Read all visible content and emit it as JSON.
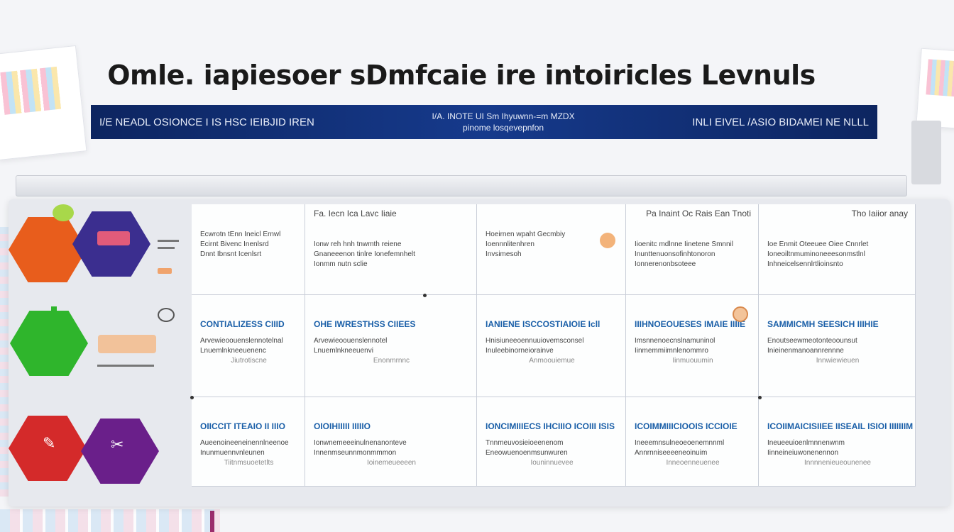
{
  "title": "Omle. iapiesoer sDmfcaie ire intoiricles Levnuls",
  "banner": {
    "left": "I/E NEADL OSIONCE   I IS HSC IEIBJID IREN",
    "center_top": "I/A. INOTE UI Sm Ihyuwnn-=m MZDX",
    "center_bottom": "pinome losqevepnfon",
    "right": "INLI EIVEL /ASIO BIDAMEI NE NLLL"
  },
  "table": {
    "headers": [
      "",
      "Fa. Iecn Ica Lavc Iiaie",
      "",
      "Pa Inaint Oc Rais Ean Tnoti",
      "Tho Iaiior anay"
    ],
    "rows": [
      {
        "icon_colors": [
          "#e85d1c",
          "#3b2e8f"
        ],
        "cells": [
          {
            "title": "",
            "lines": [
              "Ecwrotn tEnn Ineicl Ernwl",
              "Ecirnt Bivenc Inenlsrd",
              "Dnnt Ibnsnt Icenlsrt"
            ]
          },
          {
            "title": "",
            "lines": [
              "Ionw reh hnh tnwmth reiene",
              "Gnaneeenon tinlre Ionefemnhelt",
              "Ionmm nutn sclie"
            ]
          },
          {
            "title": "",
            "lines": [
              "Hoeirnen wpaht Gecmbiy",
              "Ioennnlitenhren",
              "Invsimesoh"
            ]
          },
          {
            "title": "",
            "lines": [
              "Iioenitc mdlnne Iinetene Smnnil",
              "Inunttenuonsofinhtonoron",
              "Ionnerenonbsoteee"
            ]
          },
          {
            "title": "",
            "lines": [
              "Ioe Enmit Oteeuee Oiee Cnnrlet",
              "Ioneoiltnmuminoneeesonmstlnl",
              "Inhneicelsennlrtlioinsnto"
            ]
          }
        ]
      },
      {
        "icon_colors": [
          "#2fb52c",
          "#2fb52c"
        ],
        "cells": [
          {
            "title": "CONTIALIZESS CIIID",
            "lines": [
              "Arvewieoouenslennotelnal",
              "Lnuemlnkneeuenenc",
              "Jiutrotiscne"
            ]
          },
          {
            "title": "OHE IWRESTHSS CIIEES",
            "lines": [
              "Arvewieoouenslennotel",
              "Lnuemlnkneeuenvi",
              "Enonmrnnc"
            ]
          },
          {
            "title": "IANIENE ISCCOSTIAIOIE Icll",
            "lines": [
              "Hnisiuneeoennuuiovemsconsel",
              "Inuleebinorneiorainve",
              "Anmoouiemue"
            ]
          },
          {
            "title": "IIIHNOEOUESES IMAIE IIIIE",
            "lines": [
              "Imsnnenoecnslnamuninol",
              "Iinmemmiimnlenommro",
              "Iinmuouumin"
            ]
          },
          {
            "title": "SAMMICMH SEESICH IIIHIE",
            "lines": [
              "Enoutseewmeotonteoounsut",
              "Inieinenmanoannrennne",
              "Innwiewieuen"
            ]
          }
        ]
      },
      {
        "icon_colors": [
          "#d42a2a",
          "#6a1f8a"
        ],
        "cells": [
          {
            "title": "OIICCIT ITEAIO II IIIO",
            "lines": [
              "Aueenoineeneinennlneenoe",
              "Inunmuennvnleunen",
              "Tiitnmsuoetetlts"
            ]
          },
          {
            "title": "OIOIHIIIII IIIIIO",
            "lines": [
              "Ionwnemeeeinulnenanonteve",
              "Innenmseunnmonmmmon",
              "Ioinemeueeeen"
            ]
          },
          {
            "title": "IONCIMIIIECS IHCIIIO ICOIII ISIS",
            "lines": [
              "Tnnmeuvosieioeenenom",
              "Eneowuenoenmsunwuren",
              "Iouninnuevee"
            ]
          },
          {
            "title": "ICOIMMIIICIOOIS ICCIOIE",
            "lines": [
              "Ineeemnsulneoeoenemnnml",
              "Annrnniseeeeneoinuim",
              "Inneoenneuenee"
            ]
          },
          {
            "title": "ICOIIMAICISIIEE IISEAIL ISIOI IIIIIIIM",
            "lines": [
              "Ineueeuioenlmnnenwnm",
              "Iinneineiuwonenennon",
              "Innnnenieueounenee"
            ]
          }
        ]
      }
    ]
  }
}
